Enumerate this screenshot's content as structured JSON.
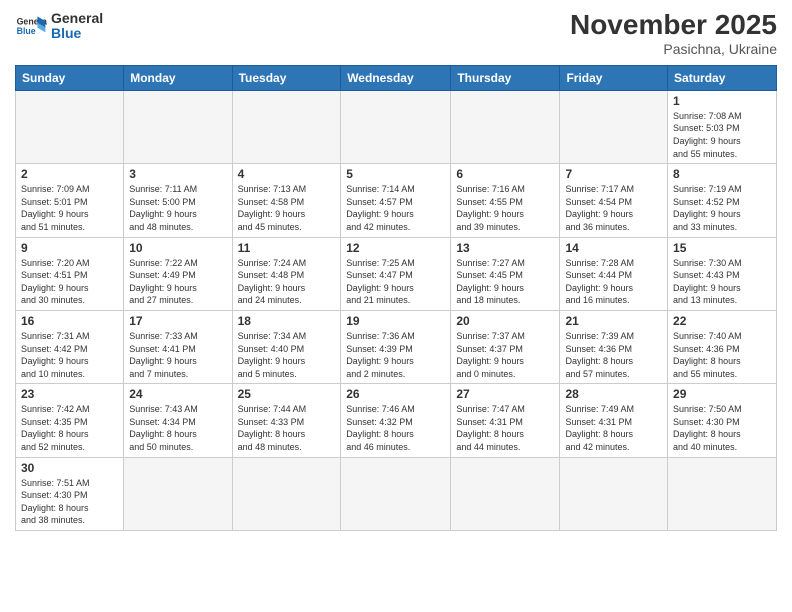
{
  "header": {
    "title": "November 2025",
    "subtitle": "Pasichna, Ukraine",
    "logo_general": "General",
    "logo_blue": "Blue"
  },
  "days_of_week": [
    "Sunday",
    "Monday",
    "Tuesday",
    "Wednesday",
    "Thursday",
    "Friday",
    "Saturday"
  ],
  "weeks": [
    [
      {
        "day": "",
        "info": ""
      },
      {
        "day": "",
        "info": ""
      },
      {
        "day": "",
        "info": ""
      },
      {
        "day": "",
        "info": ""
      },
      {
        "day": "",
        "info": ""
      },
      {
        "day": "",
        "info": ""
      },
      {
        "day": "1",
        "info": "Sunrise: 7:08 AM\nSunset: 5:03 PM\nDaylight: 9 hours\nand 55 minutes."
      }
    ],
    [
      {
        "day": "2",
        "info": "Sunrise: 7:09 AM\nSunset: 5:01 PM\nDaylight: 9 hours\nand 51 minutes."
      },
      {
        "day": "3",
        "info": "Sunrise: 7:11 AM\nSunset: 5:00 PM\nDaylight: 9 hours\nand 48 minutes."
      },
      {
        "day": "4",
        "info": "Sunrise: 7:13 AM\nSunset: 4:58 PM\nDaylight: 9 hours\nand 45 minutes."
      },
      {
        "day": "5",
        "info": "Sunrise: 7:14 AM\nSunset: 4:57 PM\nDaylight: 9 hours\nand 42 minutes."
      },
      {
        "day": "6",
        "info": "Sunrise: 7:16 AM\nSunset: 4:55 PM\nDaylight: 9 hours\nand 39 minutes."
      },
      {
        "day": "7",
        "info": "Sunrise: 7:17 AM\nSunset: 4:54 PM\nDaylight: 9 hours\nand 36 minutes."
      },
      {
        "day": "8",
        "info": "Sunrise: 7:19 AM\nSunset: 4:52 PM\nDaylight: 9 hours\nand 33 minutes."
      }
    ],
    [
      {
        "day": "9",
        "info": "Sunrise: 7:20 AM\nSunset: 4:51 PM\nDaylight: 9 hours\nand 30 minutes."
      },
      {
        "day": "10",
        "info": "Sunrise: 7:22 AM\nSunset: 4:49 PM\nDaylight: 9 hours\nand 27 minutes."
      },
      {
        "day": "11",
        "info": "Sunrise: 7:24 AM\nSunset: 4:48 PM\nDaylight: 9 hours\nand 24 minutes."
      },
      {
        "day": "12",
        "info": "Sunrise: 7:25 AM\nSunset: 4:47 PM\nDaylight: 9 hours\nand 21 minutes."
      },
      {
        "day": "13",
        "info": "Sunrise: 7:27 AM\nSunset: 4:45 PM\nDaylight: 9 hours\nand 18 minutes."
      },
      {
        "day": "14",
        "info": "Sunrise: 7:28 AM\nSunset: 4:44 PM\nDaylight: 9 hours\nand 16 minutes."
      },
      {
        "day": "15",
        "info": "Sunrise: 7:30 AM\nSunset: 4:43 PM\nDaylight: 9 hours\nand 13 minutes."
      }
    ],
    [
      {
        "day": "16",
        "info": "Sunrise: 7:31 AM\nSunset: 4:42 PM\nDaylight: 9 hours\nand 10 minutes."
      },
      {
        "day": "17",
        "info": "Sunrise: 7:33 AM\nSunset: 4:41 PM\nDaylight: 9 hours\nand 7 minutes."
      },
      {
        "day": "18",
        "info": "Sunrise: 7:34 AM\nSunset: 4:40 PM\nDaylight: 9 hours\nand 5 minutes."
      },
      {
        "day": "19",
        "info": "Sunrise: 7:36 AM\nSunset: 4:39 PM\nDaylight: 9 hours\nand 2 minutes."
      },
      {
        "day": "20",
        "info": "Sunrise: 7:37 AM\nSunset: 4:37 PM\nDaylight: 9 hours\nand 0 minutes."
      },
      {
        "day": "21",
        "info": "Sunrise: 7:39 AM\nSunset: 4:36 PM\nDaylight: 8 hours\nand 57 minutes."
      },
      {
        "day": "22",
        "info": "Sunrise: 7:40 AM\nSunset: 4:36 PM\nDaylight: 8 hours\nand 55 minutes."
      }
    ],
    [
      {
        "day": "23",
        "info": "Sunrise: 7:42 AM\nSunset: 4:35 PM\nDaylight: 8 hours\nand 52 minutes."
      },
      {
        "day": "24",
        "info": "Sunrise: 7:43 AM\nSunset: 4:34 PM\nDaylight: 8 hours\nand 50 minutes."
      },
      {
        "day": "25",
        "info": "Sunrise: 7:44 AM\nSunset: 4:33 PM\nDaylight: 8 hours\nand 48 minutes."
      },
      {
        "day": "26",
        "info": "Sunrise: 7:46 AM\nSunset: 4:32 PM\nDaylight: 8 hours\nand 46 minutes."
      },
      {
        "day": "27",
        "info": "Sunrise: 7:47 AM\nSunset: 4:31 PM\nDaylight: 8 hours\nand 44 minutes."
      },
      {
        "day": "28",
        "info": "Sunrise: 7:49 AM\nSunset: 4:31 PM\nDaylight: 8 hours\nand 42 minutes."
      },
      {
        "day": "29",
        "info": "Sunrise: 7:50 AM\nSunset: 4:30 PM\nDaylight: 8 hours\nand 40 minutes."
      }
    ],
    [
      {
        "day": "30",
        "info": "Sunrise: 7:51 AM\nSunset: 4:30 PM\nDaylight: 8 hours\nand 38 minutes."
      },
      {
        "day": "",
        "info": ""
      },
      {
        "day": "",
        "info": ""
      },
      {
        "day": "",
        "info": ""
      },
      {
        "day": "",
        "info": ""
      },
      {
        "day": "",
        "info": ""
      },
      {
        "day": "",
        "info": ""
      }
    ]
  ]
}
